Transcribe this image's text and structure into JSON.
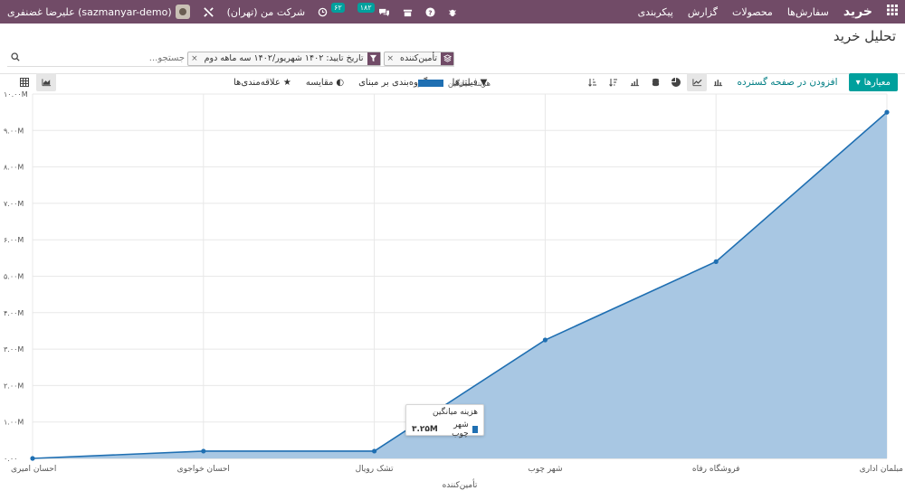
{
  "topbar": {
    "app_title": "خرید",
    "menu": [
      "سفارش‌ها",
      "محصولات",
      "گزارش",
      "پیکربندی"
    ],
    "company": "شرکت من (تهران)",
    "activity_count": "۶۲",
    "message_count": "۱۸۲",
    "user": "علیرضا غضنفری (sazmanyar-demo)",
    "accent": "#714b67"
  },
  "breadcrumb": "تحلیل خرید",
  "search": {
    "placeholder": "جستجو...",
    "facets": [
      {
        "icon": "layers-icon",
        "label": "تأمین‌کننده"
      },
      {
        "icon": "filter-icon",
        "label": "تاریخ تایید: ۱۴۰۲ شهریور/۱۴۰۲ سه ماهه دوم"
      }
    ]
  },
  "toolbar": {
    "measures_label": "معیارها",
    "insert_dashboard_label": "افزودن در صفحه گسترده",
    "filters_label": "فیلترها",
    "groupby_label": "گروه‌بندی بر مبنای",
    "compare_label": "مقایسه",
    "favorites_label": "علاقه‌مندی‌ها"
  },
  "tooltip": {
    "title": "هزینه میانگین",
    "label": "شهر چوب",
    "value": "۳.۲۵M"
  },
  "chart_data": {
    "type": "area",
    "categories": [
      "مبلمان اداری",
      "فروشگاه رفاه",
      "شهر چوب",
      "تشک رویال",
      "احسان خواجوی",
      "احسان امیری"
    ],
    "series": [
      {
        "name": "هزینه میانگین",
        "values": [
          9.5,
          5.4,
          3.25,
          0.2,
          0.2,
          0
        ],
        "color": "#1f6fb2"
      }
    ],
    "ylim": [
      0,
      10
    ],
    "yticks": [
      "۰.۰۰",
      "۱.۰۰M",
      "۲.۰۰M",
      "۳.۰۰M",
      "۴.۰۰M",
      "۵.۰۰M",
      "۶.۰۰M",
      "۷.۰۰M",
      "۸.۰۰M",
      "۹.۰۰M",
      "۱۰.۰۰M"
    ],
    "xlabel": "تأمین‌کننده",
    "legend": "top",
    "grid": true
  }
}
